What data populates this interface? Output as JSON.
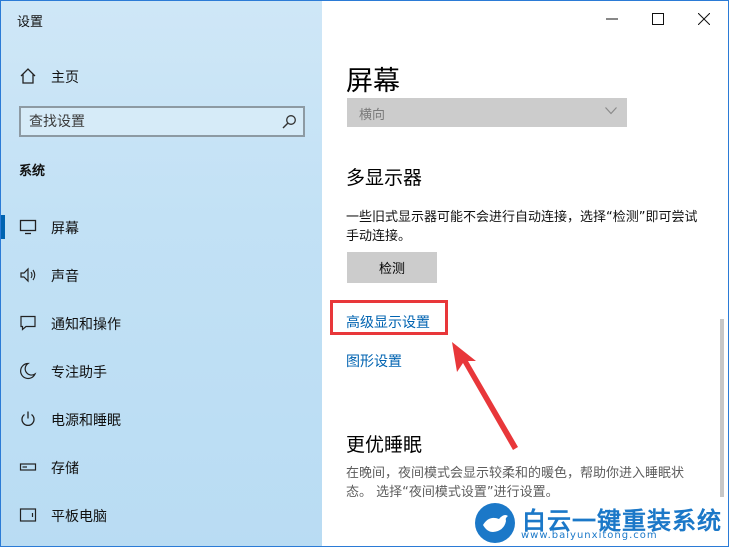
{
  "window": {
    "title": "设置"
  },
  "sidebar": {
    "home_label": "主页",
    "search_placeholder": "查找设置",
    "section_label": "系统",
    "items": [
      {
        "label": "屏幕",
        "icon": "monitor-icon",
        "selected": true
      },
      {
        "label": "声音",
        "icon": "speaker-icon",
        "selected": false
      },
      {
        "label": "通知和操作",
        "icon": "notification-icon",
        "selected": false
      },
      {
        "label": "专注助手",
        "icon": "moon-icon",
        "selected": false
      },
      {
        "label": "电源和睡眠",
        "icon": "power-icon",
        "selected": false
      },
      {
        "label": "存储",
        "icon": "storage-icon",
        "selected": false
      },
      {
        "label": "平板电脑",
        "icon": "tablet-icon",
        "selected": false
      }
    ]
  },
  "main": {
    "page_title": "屏幕",
    "orientation_value": "横向",
    "multi_display": {
      "heading": "多显示器",
      "description": "一些旧式显示器可能不会进行自动连接，选择“检测”即可尝试手动连接。",
      "detect_button": "检测"
    },
    "links": {
      "advanced_display": "高级显示设置",
      "graphics_settings": "图形设置"
    },
    "sleep": {
      "heading": "更优睡眠",
      "description": "在晚间，夜间模式会显示较柔和的暖色，帮助你进入睡眠状态。 选择“夜间模式设置”进行设置。"
    }
  },
  "watermark": {
    "brand": "白云一键重装系统",
    "url": "www.baiyunxitong.com"
  },
  "colors": {
    "accent": "#0063b1",
    "annotation": "#e8373a",
    "sidebar_bg": "#c2e1f5"
  }
}
